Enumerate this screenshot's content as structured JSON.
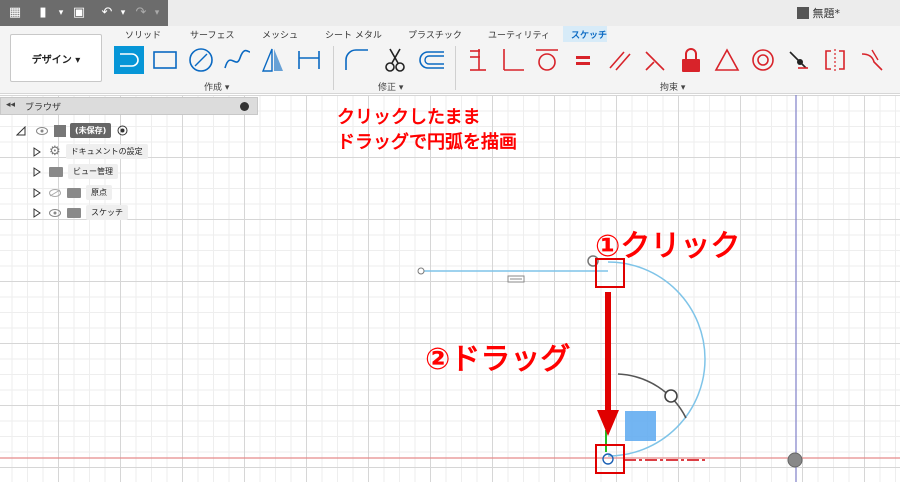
{
  "app": {
    "doc_title": "無題*"
  },
  "toolbar": {
    "design_label": "デザイン ▾"
  },
  "tabs": [
    {
      "label": "ソリッド"
    },
    {
      "label": "サーフェス"
    },
    {
      "label": "メッシュ"
    },
    {
      "label": "シート メタル"
    },
    {
      "label": "プラスチック"
    },
    {
      "label": "ユーティリティ"
    },
    {
      "label": "スケッチ",
      "active": true
    }
  ],
  "groups": {
    "create": "作成 ▾",
    "modify": "修正 ▾",
    "constraints": "拘束 ▾"
  },
  "browser": {
    "title": "ブラウザ",
    "root_label": "(未保存)",
    "items": [
      {
        "label": "ドキュメントの設定",
        "icon": "gear-icon"
      },
      {
        "label": "ビュー管理",
        "icon": "folder-icon"
      },
      {
        "label": "原点",
        "icon": "folder-icon"
      },
      {
        "label": "スケッチ",
        "icon": "folder-icon"
      }
    ]
  },
  "annotations": {
    "instruction_line1": "クリックしたまま",
    "instruction_line2": "ドラッグで円弧を描画",
    "step1": "①クリック",
    "step2": "②ドラッグ"
  },
  "colors": {
    "accent": "#0696d7",
    "annotation": "#ff0000",
    "sketch_line": "#7fc4e8",
    "constraint_red": "#d8232a"
  }
}
